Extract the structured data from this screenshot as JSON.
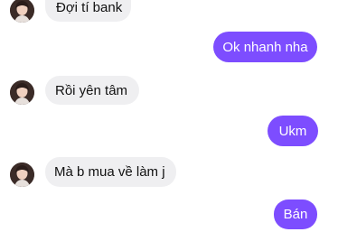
{
  "conversation": {
    "messages": [
      {
        "sender": "other",
        "text": "Đợi tí bank"
      },
      {
        "sender": "self",
        "text": "Ok nhanh nha"
      },
      {
        "sender": "other",
        "text": "Rồi yên tâm"
      },
      {
        "sender": "self",
        "text": "Ukm"
      },
      {
        "sender": "other",
        "text": "Mà b mua về làm j"
      },
      {
        "sender": "self",
        "text": "Bán"
      }
    ]
  },
  "colors": {
    "outgoing_bubble": "#7d4dff",
    "incoming_bubble": "#efeff1",
    "background": "#ffffff"
  },
  "icons": {
    "avatar": "contact-avatar-icon"
  }
}
